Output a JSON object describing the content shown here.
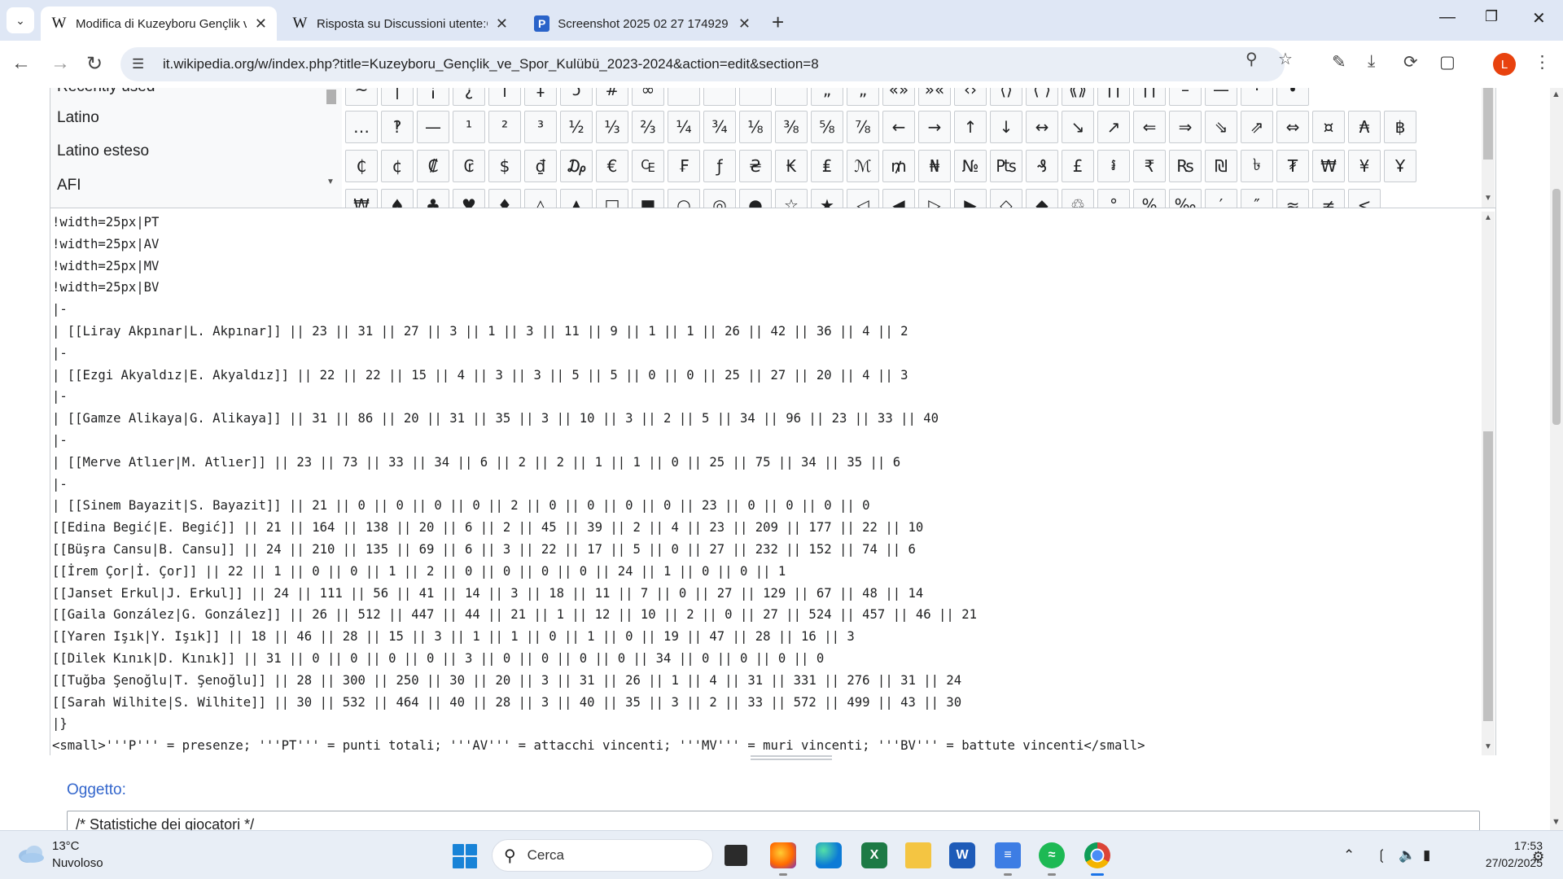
{
  "browser": {
    "tabs": [
      {
        "icon": "W",
        "title": "Modifica di Kuzeyboru Gençlik v",
        "active": true
      },
      {
        "icon": "W",
        "title": "Risposta su Discussioni utente:C",
        "active": false
      },
      {
        "icon": "P",
        "title": "Screenshot 2025 02 27 174929",
        "active": false
      }
    ],
    "url": "it.wikipedia.org/w/index.php?title=Kuzeyboru_Gençlik_ve_Spor_Kulübü_2023-2024&action=edit&section=8",
    "profile_initial": "L"
  },
  "charpanel": {
    "categories": [
      "Recently used",
      "Latino",
      "Latino esteso",
      "AFI"
    ],
    "rows": [
      [
        "~",
        "|",
        "¡",
        "¿",
        "†",
        "‡",
        "ↄ",
        "#",
        "∞",
        "‘",
        "’",
        "“",
        "”",
        "„",
        "„",
        "«»",
        "»«",
        "‹›",
        "⟨⟩",
        "⟨ ⟩",
        "⟪⟫",
        "⌈⌉",
        "⌈⌉",
        "–",
        "—",
        "·",
        "•"
      ],
      [
        "…",
        "‽",
        "—",
        "¹",
        "²",
        "³",
        "½",
        "⅓",
        "⅔",
        "¼",
        "¾",
        "⅛",
        "⅜",
        "⅝",
        "⅞",
        "←",
        "→",
        "↑",
        "↓",
        "↔",
        "↘",
        "↗",
        "⇐",
        "⇒",
        "⇘",
        "⇗",
        "⇔",
        "¤",
        "₳",
        "฿"
      ],
      [
        "₵",
        "¢",
        "₡",
        "₢",
        "$",
        "₫",
        "₯",
        "€",
        "₠",
        "₣",
        "ƒ",
        "₴",
        "₭",
        "₤",
        "ℳ",
        "₥",
        "₦",
        "№",
        "₧",
        "₰",
        "£",
        "៛",
        "₹",
        "₨",
        "₪",
        "৳",
        "₮",
        "₩",
        "¥",
        "Ұ"
      ],
      [
        "₩",
        "♠",
        "♣",
        "♥",
        "♦",
        "△",
        "▲",
        "□",
        "■",
        "○",
        "◎",
        "●",
        "☆",
        "★",
        "◁",
        "◀",
        "▷",
        "▶",
        "◇",
        "◆",
        "♲",
        "°",
        "%",
        "‰",
        "′",
        "″",
        "≈",
        "≠",
        "<"
      ]
    ]
  },
  "editor": {
    "lines": [
      "!width=25px|PT",
      "!width=25px|AV",
      "!width=25px|MV",
      "!width=25px|BV",
      "|-",
      "| [[Liray Akpınar|L. Akpınar]] || 23 || 31 || 27 || 3 || 1 || 3 || 11 || 9 || 1 || 1 || 26 || 42 || 36 || 4 || 2",
      "|-",
      "| [[Ezgi Akyaldız|E. Akyaldız]] || 22 || 22 || 15 || 4 || 3 || 3 || 5 || 5 || 0 || 0 || 25 || 27 || 20 || 4 || 3",
      "|-",
      "| [[Gamze Alikaya|G. Alikaya]] || 31 || 86 || 20 || 31 || 35 || 3 || 10 || 3 || 2 || 5 || 34 || 96 || 23 || 33 || 40",
      "|-",
      "| [[Merve Atlıer|M. Atlıer]] || 23 || 73 || 33 || 34 || 6 || 2 || 2 || 1 || 1 || 0 || 25 || 75 || 34 || 35 || 6",
      "|-",
      "| [[Sinem Bayazit|S. Bayazit]] || 21 || 0 || 0 || 0 || 0 || 2 || 0 || 0 || 0 || 0 || 23 || 0 || 0 || 0 || 0",
      "[[Edina Begić|E. Begić]] || 21 || 164 || 138 || 20 || 6 || 2 || 45 || 39 || 2 || 4 || 23 || 209 || 177 || 22 || 10",
      "[[Büşra Cansu|B. Cansu]] || 24 || 210 || 135 || 69 || 6 || 3 || 22 || 17 || 5 || 0 || 27 || 232 || 152 || 74 || 6",
      "[[İrem Çor|İ. Çor]] || 22 || 1 || 0 || 0 || 1 || 2 || 0 || 0 || 0 || 0 || 24 || 1 || 0 || 0 || 1",
      "[[Janset Erkul|J. Erkul]] || 24 || 111 || 56 || 41 || 14 || 3 || 18 || 11 || 7 || 0 || 27 || 129 || 67 || 48 || 14",
      "[[Gaila González|G. González]] || 26 || 512 || 447 || 44 || 21 || 1 || 12 || 10 || 2 || 0 || 27 || 524 || 457 || 46 || 21",
      "[[Yaren Işık|Y. Işık]] || 18 || 46 || 28 || 15 || 3 || 1 || 1 || 0 || 1 || 0 || 19 || 47 || 28 || 16 || 3",
      "[[Dilek Kınık|D. Kınık]] || 31 || 0 || 0 || 0 || 0 || 3 || 0 || 0 || 0 || 0 || 34 || 0 || 0 || 0 || 0",
      "[[Tuğba Şenoğlu|T. Şenoğlu]] || 28 || 300 || 250 || 30 || 20 || 3 || 31 || 26 || 1 || 4 || 31 || 331 || 276 || 31 || 24",
      "[[Sarah Wilhite|S. Wilhite]] || 30 || 532 || 464 || 40 || 28 || 3 || 40 || 35 || 3 || 2 || 33 || 572 || 499 || 43 || 30",
      "|}",
      "<small>'''P''' = presenze; '''PT''' = punti totali; '''AV''' = attacchi vincenti; '''MV''' = muri vincenti; '''BV''' = battute vincenti</small>"
    ],
    "summary_label": "Oggetto:",
    "summary_value": "/* Statistiche dei giocatori */"
  },
  "taskbar": {
    "weather_temp": "13°C",
    "weather_desc": "Nuvoloso",
    "search_placeholder": "Cerca",
    "time": "17:53",
    "date": "27/02/2025"
  },
  "colors": {
    "link": "#3366cc",
    "tabstrip": "#dfe7f5",
    "omnibox": "#e9eef6",
    "profile": "#e8420e",
    "taskbar": "#e8eef6"
  }
}
